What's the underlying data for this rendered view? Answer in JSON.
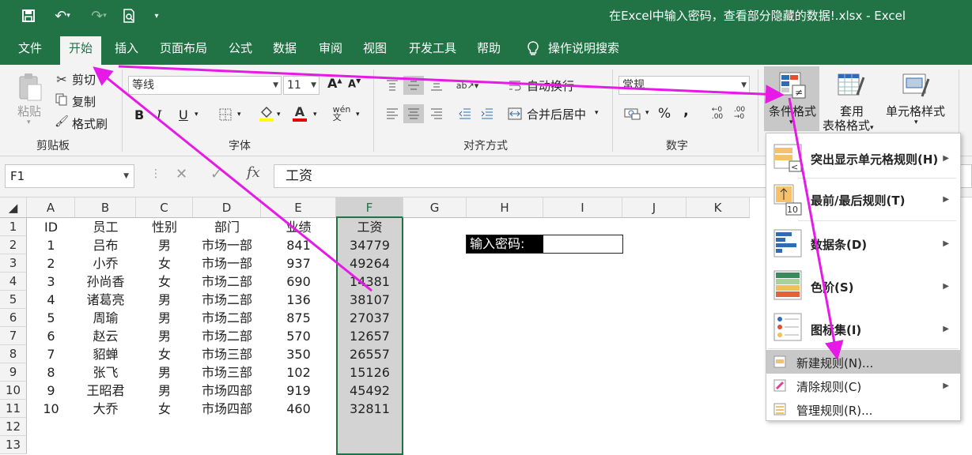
{
  "title_bar": {
    "title": "在Excel中输入密码，查看部分隐藏的数据!.xlsx  -  Excel"
  },
  "tabs": [
    {
      "label": "文件"
    },
    {
      "label": "开始"
    },
    {
      "label": "插入"
    },
    {
      "label": "页面布局"
    },
    {
      "label": "公式"
    },
    {
      "label": "数据"
    },
    {
      "label": "审阅"
    },
    {
      "label": "视图"
    },
    {
      "label": "开发工具"
    },
    {
      "label": "帮助"
    },
    {
      "label": "操作说明搜索"
    }
  ],
  "ribbon": {
    "clipboard": {
      "paste": "粘贴",
      "cut": "剪切",
      "copy": "复制",
      "format_painter": "格式刷",
      "group": "剪贴板"
    },
    "font": {
      "name": "等线",
      "size": "11",
      "group": "字体",
      "bold": "B",
      "italic": "I",
      "underline": "U",
      "grow": "A",
      "shrink": "A",
      "color_a": "A"
    },
    "alignment": {
      "wrap": "自动换行",
      "merge": "合并后居中",
      "group": "对齐方式"
    },
    "number": {
      "format": "常规",
      "percent": "%",
      "comma": ",",
      "group": "数字"
    },
    "styles": {
      "conditional": "条件格式",
      "table_format_1": "套用",
      "table_format_2": "表格格式",
      "cell_styles": "单元格样式"
    }
  },
  "formula_bar": {
    "name_box": "F1",
    "content": "工资"
  },
  "grid": {
    "columns": [
      "A",
      "B",
      "C",
      "D",
      "E",
      "F",
      "G",
      "H",
      "I",
      "J",
      "K"
    ],
    "rows": [
      "1",
      "2",
      "3",
      "4",
      "5",
      "6",
      "7",
      "8",
      "9",
      "10",
      "11",
      "12",
      "13"
    ],
    "header": [
      "ID",
      "员工",
      "性别",
      "部门",
      "业绩",
      "工资"
    ],
    "data": [
      [
        "1",
        "吕布",
        "男",
        "市场一部",
        "841",
        "34779"
      ],
      [
        "2",
        "小乔",
        "女",
        "市场一部",
        "937",
        "49264"
      ],
      [
        "3",
        "孙尚香",
        "女",
        "市场二部",
        "690",
        "14381"
      ],
      [
        "4",
        "诸葛亮",
        "男",
        "市场二部",
        "136",
        "38107"
      ],
      [
        "5",
        "周瑜",
        "男",
        "市场二部",
        "875",
        "27037"
      ],
      [
        "6",
        "赵云",
        "男",
        "市场二部",
        "570",
        "12657"
      ],
      [
        "7",
        "貂蝉",
        "女",
        "市场三部",
        "350",
        "26557"
      ],
      [
        "8",
        "张飞",
        "男",
        "市场三部",
        "102",
        "15126"
      ],
      [
        "9",
        "王昭君",
        "男",
        "市场四部",
        "919",
        "45492"
      ],
      [
        "10",
        "大乔",
        "女",
        "市场四部",
        "460",
        "32811"
      ]
    ],
    "password_label": "输入密码:"
  },
  "dropdown": {
    "items": [
      {
        "label": "突出显示单元格规则(H)"
      },
      {
        "label": "最前/最后规则(T)"
      },
      {
        "label": "数据条(D)"
      },
      {
        "label": "色阶(S)"
      },
      {
        "label": "图标集(I)"
      }
    ],
    "new_rule": "新建规则(N)...",
    "clear_rules": "清除规则(C)",
    "manage_rules": "管理规则(R)..."
  },
  "colors": {
    "accent": "#217346",
    "annotation_arrow": "#e619e6",
    "selection": "#d3d3d3"
  }
}
